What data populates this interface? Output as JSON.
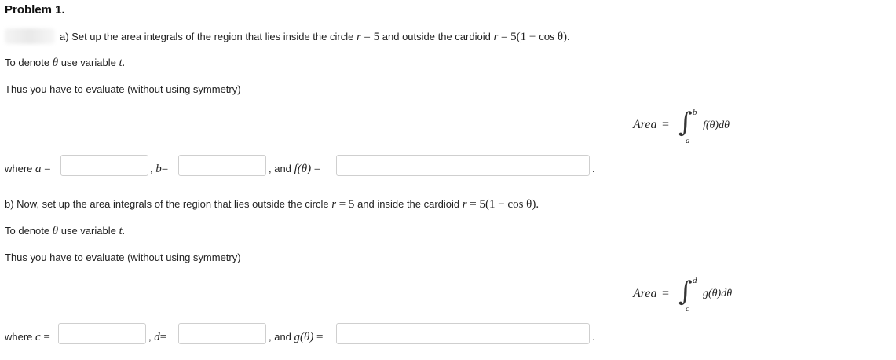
{
  "problem_title": "Problem 1.",
  "part_a": {
    "intro": "a) Set up the area integrals of the region that lies inside the circle",
    "circle_var": "r",
    "circle_eq": "= 5",
    "mid": "and outside the cardioid",
    "cardioid_var": "r",
    "cardioid_eq": "= 5(1 − cos θ).",
    "denote_pre": "To denote",
    "denote_theta": "θ",
    "denote_post": "use variable",
    "denote_t": "t.",
    "evaluate": "Thus you have to evaluate (without using symmetry)",
    "area_label": "Area",
    "area_eq": "=",
    "upper": "b",
    "lower": "a",
    "integrand": "f(θ)dθ",
    "where_label": "where",
    "a_var": "a",
    "a_eq": "=",
    "b_var": "b",
    "b_eq": "=",
    "and_label": ", and",
    "f_var": "f(θ)",
    "f_eq": "=",
    "comma": ",",
    "period": "."
  },
  "part_b": {
    "intro": "b) Now, set up the area integrals of the region that lies outside the circle",
    "circle_var": "r",
    "circle_eq": "= 5",
    "mid": "and inside the cardioid",
    "cardioid_var": "r",
    "cardioid_eq": "= 5(1 − cos θ).",
    "denote_pre": "To denote",
    "denote_theta": "θ",
    "denote_post": "use variable",
    "denote_t": "t.",
    "evaluate": "Thus you have to evaluate (without using symmetry)",
    "area_label": "Area",
    "area_eq": "=",
    "upper": "d",
    "lower": "c",
    "integrand": "g(θ)dθ",
    "where_label": "where",
    "c_var": "c",
    "c_eq": "=",
    "d_var": "d",
    "d_eq": "=",
    "and_label": ", and",
    "g_var": "g(θ)",
    "g_eq": "=",
    "comma": ",",
    "period": "."
  },
  "inputs": {
    "a_value": "",
    "b_value": "",
    "f_value": "",
    "c_value": "",
    "d_value": "",
    "g_value": ""
  }
}
